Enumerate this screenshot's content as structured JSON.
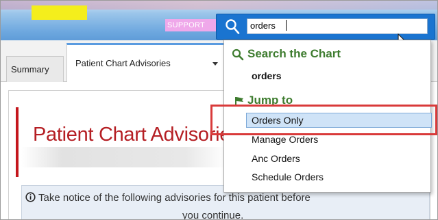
{
  "header": {
    "support_tag": "SUPPORT"
  },
  "search": {
    "value": "orders"
  },
  "tabs": {
    "summary": "Summary",
    "advisories": "Patient Chart Advisories"
  },
  "dropdown": {
    "search_heading": "Search the Chart",
    "search_query": "orders",
    "jump_heading": "Jump to",
    "items": [
      "Orders Only",
      "Manage Orders",
      "Anc Orders",
      "Schedule Orders"
    ],
    "selected_index": 0
  },
  "content": {
    "title": "Patient Chart Advisories",
    "notice_line1": "Take notice of the following advisories for this patient before",
    "notice_line2": "you continue."
  },
  "colors": {
    "title_red": "#b51f24",
    "search_blue": "#1a74d0",
    "heading_green": "#3e7c2f",
    "highlight_yellow": "#f4ee1c",
    "annotation_red": "#d93a3a"
  }
}
